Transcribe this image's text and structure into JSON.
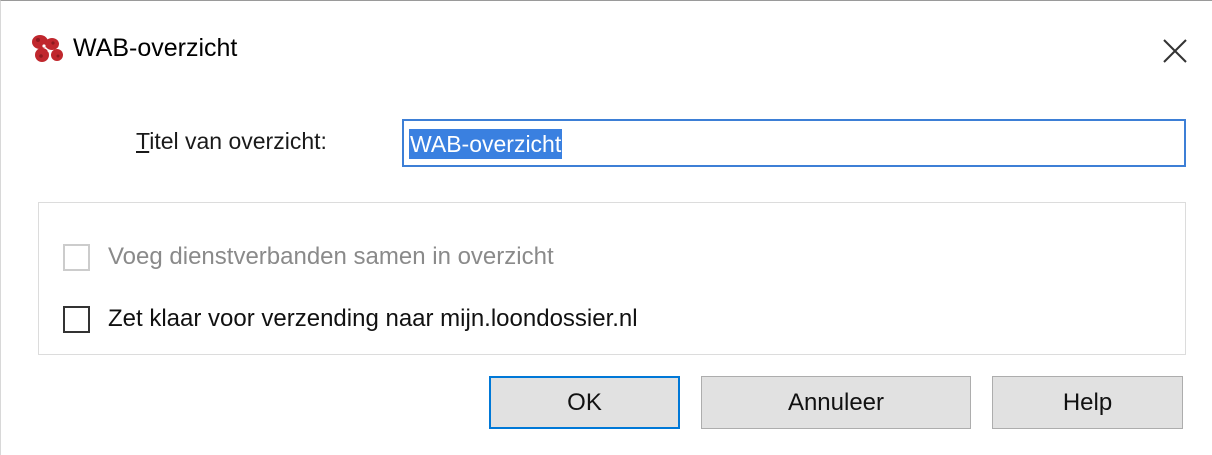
{
  "window": {
    "title": "WAB-overzicht",
    "icon": "app-logo-icon",
    "close_icon": "close-icon"
  },
  "form": {
    "title_label_mnemonic": "T",
    "title_label_rest": "itel van overzicht:",
    "title_value": "WAB-overzicht"
  },
  "options": {
    "merge_label": "Voeg dienstverbanden samen in overzicht",
    "merge_checked": false,
    "merge_enabled": false,
    "send_label": "Zet klaar voor verzending naar mijn.loondossier.nl",
    "send_checked": false,
    "send_enabled": true
  },
  "buttons": {
    "ok_label": "OK",
    "cancel_label": "Annuleer",
    "help_label": "Help"
  },
  "colors": {
    "accent": "#0078d7",
    "selection": "#3a80e0",
    "logo": "#c0272d"
  }
}
